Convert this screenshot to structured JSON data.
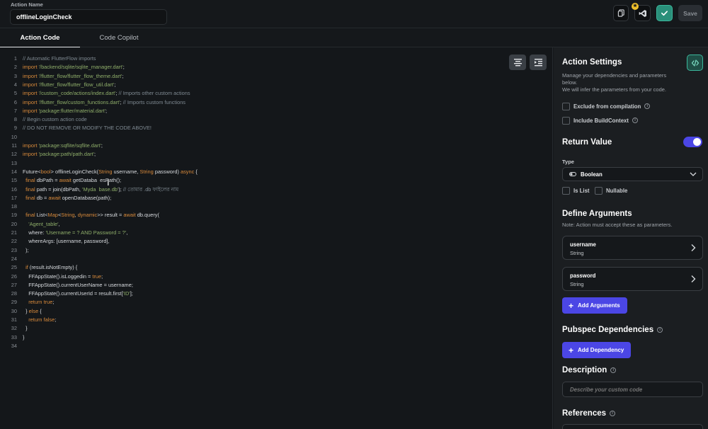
{
  "header": {
    "action_name_label": "Action Name",
    "action_name_value": "offlineLoginCheck",
    "save_label": "Save"
  },
  "tabs": [
    {
      "label": "Action Code",
      "active": true
    },
    {
      "label": "Code Copilot",
      "active": false
    }
  ],
  "editor": {
    "lines": [
      {
        "n": "1",
        "tokens": [
          {
            "t": "// Automatic FlutterFlow imports",
            "k": "comment"
          }
        ]
      },
      {
        "n": "2",
        "tokens": [
          {
            "t": "import",
            "k": "kw"
          },
          {
            "t": " '/backend/sqlite/sqlite_manager.dart'",
            "k": "str"
          },
          {
            "t": ";",
            "k": "plain"
          }
        ]
      },
      {
        "n": "3",
        "tokens": [
          {
            "t": "import",
            "k": "kw"
          },
          {
            "t": " '/flutter_flow/flutter_flow_theme.dart'",
            "k": "str"
          },
          {
            "t": ";",
            "k": "plain"
          }
        ]
      },
      {
        "n": "4",
        "tokens": [
          {
            "t": "import",
            "k": "kw"
          },
          {
            "t": " '/flutter_flow/flutter_flow_util.dart'",
            "k": "str"
          },
          {
            "t": ";",
            "k": "plain"
          }
        ]
      },
      {
        "n": "5",
        "tokens": [
          {
            "t": "import",
            "k": "kw"
          },
          {
            "t": " '/custom_code/actions/index.dart'",
            "k": "str"
          },
          {
            "t": "; ",
            "k": "plain"
          },
          {
            "t": "// Imports other custom actions",
            "k": "comment"
          }
        ]
      },
      {
        "n": "6",
        "tokens": [
          {
            "t": "import",
            "k": "kw"
          },
          {
            "t": " '/flutter_flow/custom_functions.dart'",
            "k": "str"
          },
          {
            "t": "; ",
            "k": "plain"
          },
          {
            "t": "// Imports custom functions",
            "k": "comment"
          }
        ]
      },
      {
        "n": "7",
        "tokens": [
          {
            "t": "import",
            "k": "kw"
          },
          {
            "t": " 'package:flutter/material.dart'",
            "k": "str"
          },
          {
            "t": ";",
            "k": "plain"
          }
        ]
      },
      {
        "n": "8",
        "tokens": [
          {
            "t": "// Begin custom action code",
            "k": "comment"
          }
        ]
      },
      {
        "n": "9",
        "tokens": [
          {
            "t": "// DO NOT REMOVE OR MODIFY THE CODE ABOVE!",
            "k": "comment"
          }
        ]
      },
      {
        "n": "10",
        "tokens": []
      },
      {
        "n": "11",
        "tokens": [
          {
            "t": "import",
            "k": "kw"
          },
          {
            "t": " 'package:sqflite/sqflite.dart'",
            "k": "str"
          },
          {
            "t": ";",
            "k": "plain"
          }
        ]
      },
      {
        "n": "12",
        "tokens": [
          {
            "t": "import",
            "k": "kw"
          },
          {
            "t": " 'package:path/path.dart'",
            "k": "str"
          },
          {
            "t": ";",
            "k": "plain"
          }
        ]
      },
      {
        "n": "13",
        "tokens": []
      },
      {
        "n": "14",
        "tokens": [
          {
            "t": "Future<",
            "k": "plain"
          },
          {
            "t": "bool",
            "k": "kw"
          },
          {
            "t": "> offlineLoginCheck(",
            "k": "plain"
          },
          {
            "t": "String",
            "k": "kw"
          },
          {
            "t": " username, ",
            "k": "plain"
          },
          {
            "t": "String",
            "k": "kw"
          },
          {
            "t": " password) ",
            "k": "plain"
          },
          {
            "t": "async",
            "k": "kw"
          },
          {
            "t": " {",
            "k": "plain"
          }
        ]
      },
      {
        "n": "15",
        "tokens": [
          {
            "t": "  ",
            "k": "plain"
          },
          {
            "t": "final",
            "k": "kw"
          },
          {
            "t": " dbPath = ",
            "k": "plain"
          },
          {
            "t": "await",
            "k": "kw"
          },
          {
            "t": " getDataba  esPath();",
            "k": "plain"
          }
        ]
      },
      {
        "n": "16",
        "tokens": [
          {
            "t": "  ",
            "k": "plain"
          },
          {
            "t": "final",
            "k": "kw"
          },
          {
            "t": " path = join(dbPath, ",
            "k": "plain"
          },
          {
            "t": "'Myda  base.db'",
            "k": "str"
          },
          {
            "t": "); ",
            "k": "plain"
          },
          {
            "t": "// তোমার .db ফাইলের নাম",
            "k": "comment"
          }
        ]
      },
      {
        "n": "17",
        "tokens": [
          {
            "t": "  ",
            "k": "plain"
          },
          {
            "t": "final",
            "k": "kw"
          },
          {
            "t": " db = ",
            "k": "plain"
          },
          {
            "t": "await",
            "k": "kw"
          },
          {
            "t": " openDatabase(path);",
            "k": "plain"
          }
        ]
      },
      {
        "n": "18",
        "tokens": []
      },
      {
        "n": "19",
        "tokens": [
          {
            "t": "  ",
            "k": "plain"
          },
          {
            "t": "final",
            "k": "kw"
          },
          {
            "t": " List<",
            "k": "plain"
          },
          {
            "t": "Map",
            "k": "kw"
          },
          {
            "t": "<",
            "k": "plain"
          },
          {
            "t": "String",
            "k": "kw"
          },
          {
            "t": ", ",
            "k": "plain"
          },
          {
            "t": "dynamic",
            "k": "kw"
          },
          {
            "t": ">> result = ",
            "k": "plain"
          },
          {
            "t": "await",
            "k": "kw"
          },
          {
            "t": " db.query(",
            "k": "plain"
          }
        ]
      },
      {
        "n": "20",
        "tokens": [
          {
            "t": "    ",
            "k": "plain"
          },
          {
            "t": "'Agent_table'",
            "k": "str"
          },
          {
            "t": ",",
            "k": "plain"
          }
        ]
      },
      {
        "n": "21",
        "tokens": [
          {
            "t": "    where: ",
            "k": "plain"
          },
          {
            "t": "'Username = ? AND Password = ?'",
            "k": "str"
          },
          {
            "t": ",",
            "k": "plain"
          }
        ]
      },
      {
        "n": "22",
        "tokens": [
          {
            "t": "    whereArgs: [username, password],",
            "k": "plain"
          }
        ]
      },
      {
        "n": "23",
        "tokens": [
          {
            "t": "  );",
            "k": "plain"
          }
        ]
      },
      {
        "n": "24",
        "tokens": []
      },
      {
        "n": "25",
        "tokens": [
          {
            "t": "  ",
            "k": "plain"
          },
          {
            "t": "if",
            "k": "kw"
          },
          {
            "t": " (result.isNotEmpty) {",
            "k": "plain"
          }
        ]
      },
      {
        "n": "26",
        "tokens": [
          {
            "t": "    FFAppState().isLoggedin = ",
            "k": "plain"
          },
          {
            "t": "true",
            "k": "kw"
          },
          {
            "t": ";",
            "k": "plain"
          }
        ]
      },
      {
        "n": "27",
        "tokens": [
          {
            "t": "    FFAppState().currentUserName = username;",
            "k": "plain"
          }
        ]
      },
      {
        "n": "28",
        "tokens": [
          {
            "t": "    FFAppState().currentUserId = result.first[",
            "k": "plain"
          },
          {
            "t": "'ID'",
            "k": "str"
          },
          {
            "t": "];",
            "k": "plain"
          }
        ]
      },
      {
        "n": "29",
        "tokens": [
          {
            "t": "    ",
            "k": "plain"
          },
          {
            "t": "return",
            "k": "kw"
          },
          {
            "t": " ",
            "k": "plain"
          },
          {
            "t": "true",
            "k": "kw"
          },
          {
            "t": ";",
            "k": "plain"
          }
        ]
      },
      {
        "n": "30",
        "tokens": [
          {
            "t": "  } ",
            "k": "plain"
          },
          {
            "t": "else",
            "k": "kw"
          },
          {
            "t": " {",
            "k": "plain"
          }
        ]
      },
      {
        "n": "31",
        "tokens": [
          {
            "t": "    ",
            "k": "plain"
          },
          {
            "t": "return",
            "k": "kw"
          },
          {
            "t": " ",
            "k": "plain"
          },
          {
            "t": "false",
            "k": "kw"
          },
          {
            "t": ";",
            "k": "plain"
          }
        ]
      },
      {
        "n": "32",
        "tokens": [
          {
            "t": "  }",
            "k": "plain"
          }
        ]
      },
      {
        "n": "33",
        "tokens": [
          {
            "t": "}",
            "k": "plain"
          }
        ]
      },
      {
        "n": "34",
        "tokens": []
      }
    ]
  },
  "settings": {
    "title": "Action Settings",
    "desc_line1": "Manage your dependencies and parameters",
    "desc_line2": "below.",
    "desc_line3": "We will infer the parameters from your code.",
    "exclude_label": "Exclude from compilation",
    "exclude_checked": false,
    "buildcontext_label": "Include BuildContext",
    "buildcontext_checked": false
  },
  "return_value": {
    "title": "Return Value",
    "enabled": true,
    "type_label": "Type",
    "type_value": "Boolean",
    "is_list_label": "Is List",
    "nullable_label": "Nullable"
  },
  "arguments": {
    "title": "Define Arguments",
    "note": "Note: Action must accept these as parameters.",
    "items": [
      {
        "name": "username",
        "type": "String"
      },
      {
        "name": "password",
        "type": "String"
      }
    ],
    "add_label": "Add Arguments"
  },
  "pubspec": {
    "title": "Pubspec Dependencies",
    "add_label": "Add Dependency"
  },
  "description": {
    "title": "Description",
    "placeholder": "Describe your custom code"
  },
  "references": {
    "title": "References"
  },
  "colors": {
    "accent": "#4b46e5",
    "teal": "#2a8f7a",
    "keyword": "#d88a3b",
    "string": "#8fae6a",
    "comment": "#7f8a92"
  }
}
